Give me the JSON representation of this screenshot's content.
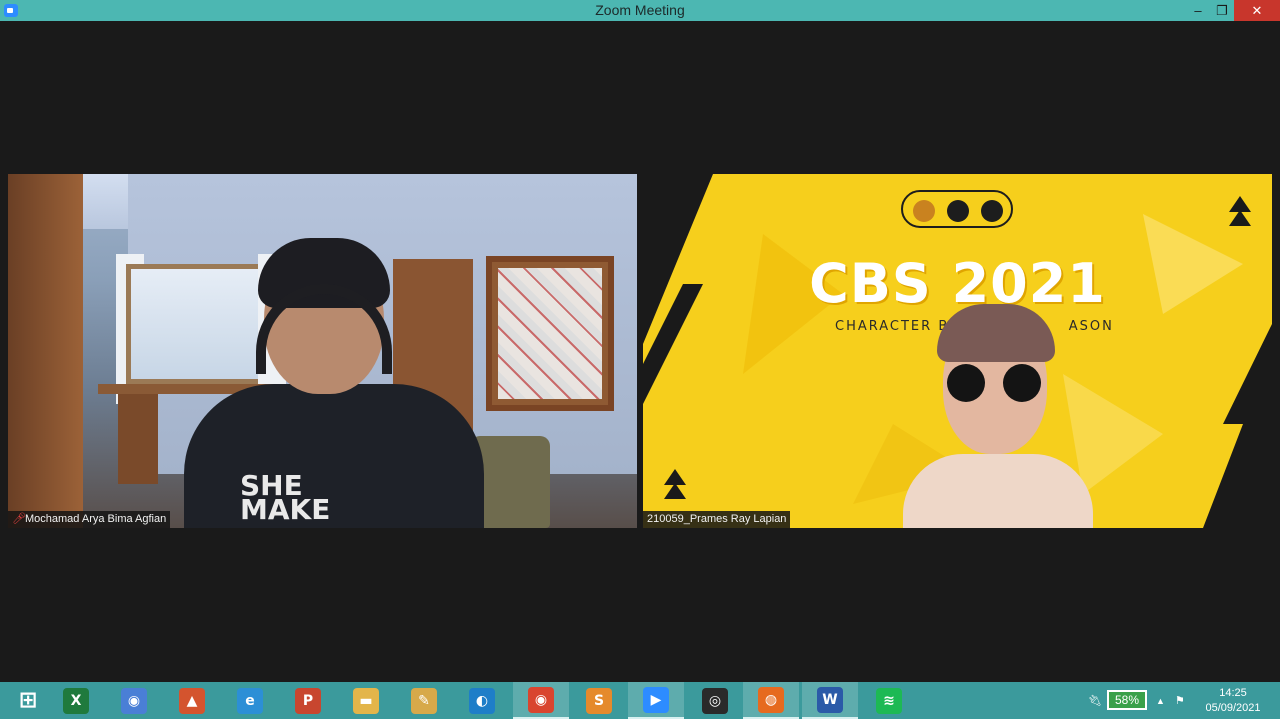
{
  "window": {
    "title": "Zoom Meeting",
    "minimize_glyph": "–",
    "maximize_glyph": "❐",
    "close_glyph": "✕"
  },
  "participants": [
    {
      "name": "Mochamad Arya Bima Agfian",
      "muted": true,
      "shirt_text": "SHE\nMAKE"
    },
    {
      "name": "210059_Prames Ray Lapian",
      "muted": false
    }
  ],
  "background_banner": {
    "title": "CBS 2021",
    "subtitle": "CHARACTER BU",
    "subtitle_tail": "ASON"
  },
  "taskbar": {
    "apps": [
      {
        "name": "start-icon",
        "glyph": "⊞",
        "color": "#3b9a9c"
      },
      {
        "name": "excel-icon",
        "glyph": "X",
        "color": "#1f7a3d"
      },
      {
        "name": "chrome-circle-icon",
        "glyph": "◉",
        "color": "#4a7fd6"
      },
      {
        "name": "matlab-icon",
        "glyph": "▲",
        "color": "#d4542e"
      },
      {
        "name": "internet-explorer-icon",
        "glyph": "e",
        "color": "#2c8fd6"
      },
      {
        "name": "powerpoint-icon",
        "glyph": "P",
        "color": "#c8462f"
      },
      {
        "name": "file-explorer-icon",
        "glyph": "▬",
        "color": "#e3b54a"
      },
      {
        "name": "paint-icon",
        "glyph": "✎",
        "color": "#d7a94a"
      },
      {
        "name": "edge-icon",
        "glyph": "◐",
        "color": "#1e7ec8"
      },
      {
        "name": "chrome-icon",
        "glyph": "◉",
        "color": "#d9452f"
      },
      {
        "name": "sublime-text-icon",
        "glyph": "S",
        "color": "#e58a2c"
      },
      {
        "name": "zoom-icon",
        "glyph": "▶",
        "color": "#2d8cff"
      },
      {
        "name": "gauge-app-icon",
        "glyph": "◎",
        "color": "#2a2a2a"
      },
      {
        "name": "firefox-icon",
        "glyph": "◍",
        "color": "#e66a1f"
      },
      {
        "name": "word-icon",
        "glyph": "W",
        "color": "#2b5aa8"
      },
      {
        "name": "spotify-icon",
        "glyph": "≋",
        "color": "#1db954"
      }
    ],
    "battery_percent": "58%",
    "tray_up_arrow": "▲",
    "time": "14:25",
    "date": "05/09/2021"
  }
}
